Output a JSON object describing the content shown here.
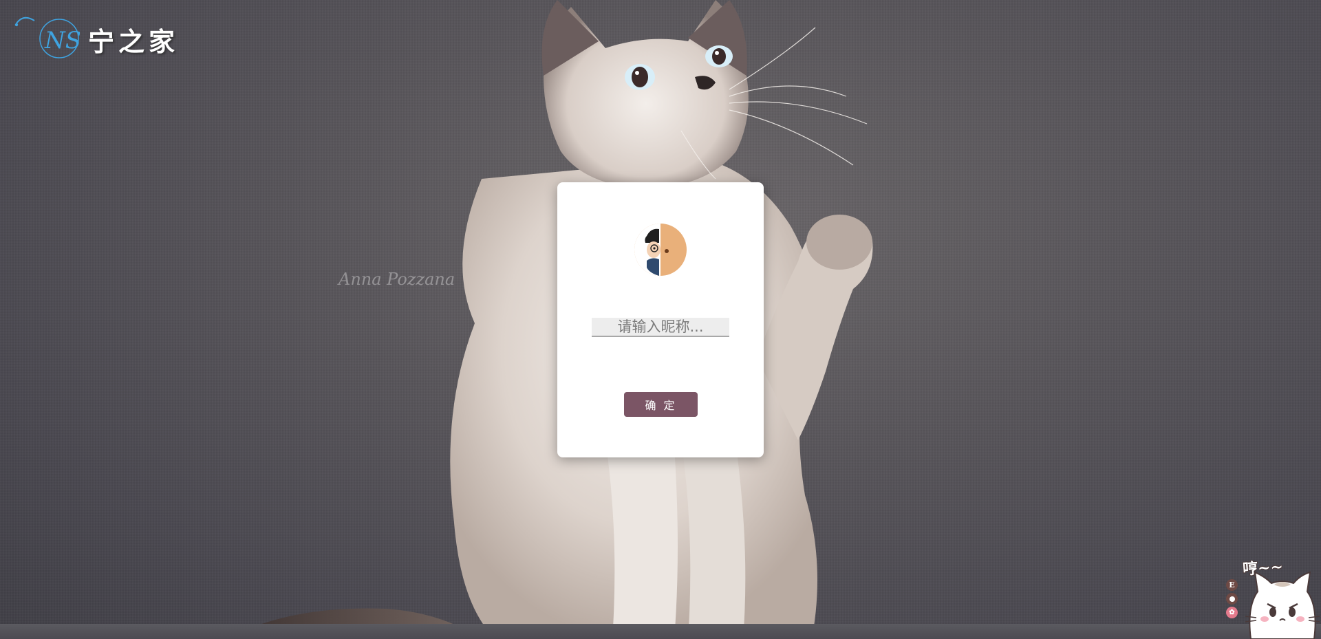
{
  "site": {
    "logo_initials": "NS",
    "logo_title": "宁之家"
  },
  "background": {
    "watermark_text": "Anna Pozzana"
  },
  "login_card": {
    "avatar": "cartoon-boy-avatar",
    "nickname_placeholder": "请输入昵称...",
    "nickname_value": "",
    "confirm_label": "确 定"
  },
  "widgets": {
    "side_buttons": [
      "E",
      "",
      "✿"
    ],
    "mascot_speech": "哼~~"
  },
  "colors": {
    "button": "#7b5565",
    "card": "#ffffff",
    "background": "#55535a"
  }
}
